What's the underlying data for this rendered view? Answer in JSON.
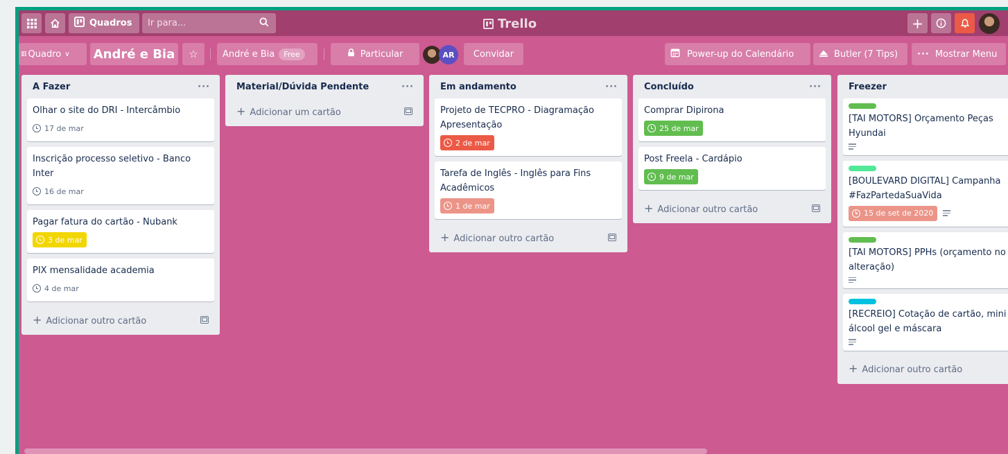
{
  "topbar": {
    "boards_label": "Quadros",
    "search_placeholder": "Ir para...",
    "logo_text": "Trello"
  },
  "board_header": {
    "view_label": "Quadro",
    "board_name": "André e Bia",
    "team_name": "André e Bia",
    "team_badge": "Free",
    "visibility_label": "Particular",
    "member_initials": "AR",
    "invite_label": "Convidar",
    "calendar_label": "Power-up do Calendário",
    "butler_label": "Butler (7 Tips)",
    "menu_label": "Mostrar Menu"
  },
  "lists": [
    {
      "title": "A Fazer",
      "cards": [
        {
          "title": "Olhar o site do DRI - Intercâmbio",
          "due": "17 de mar",
          "due_color": "none"
        },
        {
          "title": "Inscrição processo seletivo - Banco Inter",
          "due": "16 de mar",
          "due_color": "none"
        },
        {
          "title": "Pagar fatura do cartão - Nubank",
          "due": "3 de mar",
          "due_color": "#f2d600"
        },
        {
          "title": "PIX mensalidade academia",
          "due": "4 de mar",
          "due_color": "none"
        }
      ],
      "add_label": "Adicionar outro cartão"
    },
    {
      "title": "Material/Dúvida Pendente",
      "cards": [],
      "add_label": "Adicionar um cartão"
    },
    {
      "title": "Em andamento",
      "cards": [
        {
          "title": "Projeto de TECPRO - Diagramação Apresentação",
          "due": "2 de mar",
          "due_color": "#eb5a46"
        },
        {
          "title": "Tarefa de Inglês - Inglês para Fins Acadêmicos",
          "due": "1 de mar",
          "due_color": "#ec9488"
        }
      ],
      "add_label": "Adicionar outro cartão"
    },
    {
      "title": "Concluído",
      "cards": [
        {
          "title": "Comprar Dipirona",
          "due": "25 de mar",
          "due_color": "#61bd4f"
        },
        {
          "title": "Post Freela - Cardápio",
          "due": "9 de mar",
          "due_color": "#61bd4f"
        }
      ],
      "add_label": "Adicionar outro cartão"
    },
    {
      "title": "Freezer",
      "cards": [
        {
          "title": "[TAI MOTORS] Orçamento Peças Hyundai",
          "label_color": "#61bd4f",
          "has_description": true
        },
        {
          "title": "[BOULEVARD DIGITAL] Campanha #FazPartedaSuaVida",
          "label_color": "#51e898",
          "due": "15 de set de 2020",
          "due_color": "#ec9488",
          "has_description": true
        },
        {
          "title": "[TAI MOTORS] PPHs (orçamento no e alteração)",
          "label_color": "#61bd4f",
          "has_description": true
        },
        {
          "title": "[RECREIO] Cotação de cartão, mini álcool gel e máscara",
          "label_color": "#00c2e0",
          "has_description": true
        }
      ],
      "add_label": "Adicionar outro cartão"
    }
  ],
  "colors": {
    "board_background": "#cd5a91",
    "topbar": "#a13f6e",
    "frame_border": "#00a080",
    "notification": "#eb5a46"
  }
}
